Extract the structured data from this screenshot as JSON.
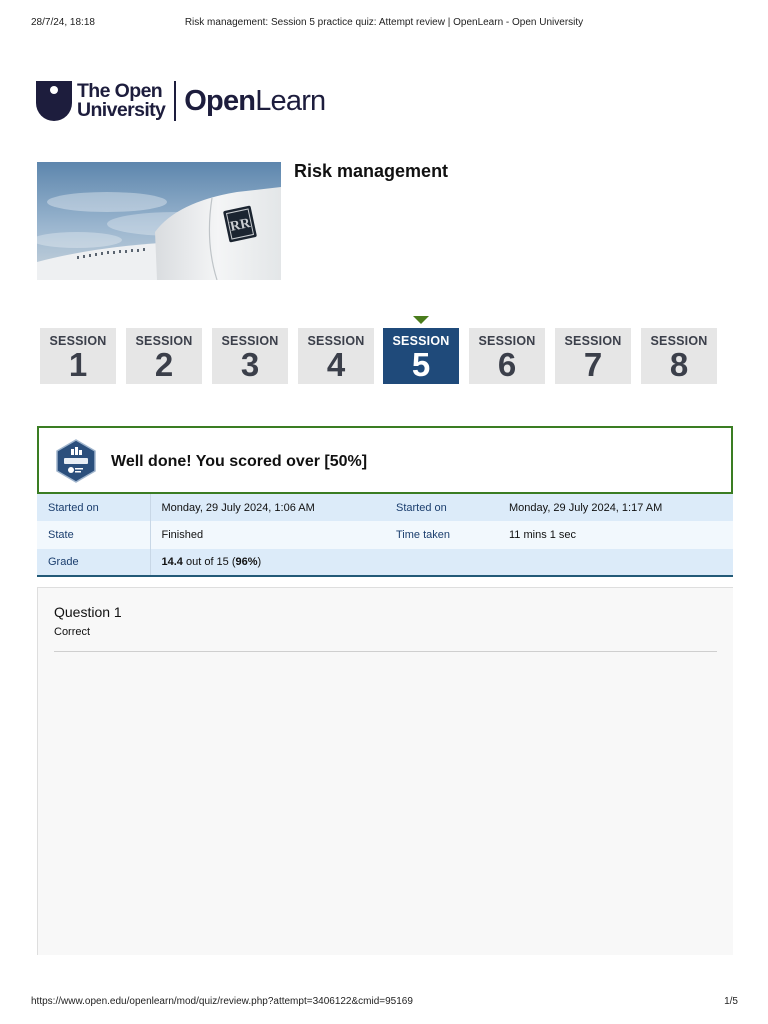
{
  "print_header": {
    "date": "28/7/24, 18:18",
    "title": "Risk management: Session 5 practice quiz: Attempt review | OpenLearn - Open University"
  },
  "logo": {
    "ou_line1": "The Open",
    "ou_line2": "University",
    "openlearn_bold": "Open",
    "openlearn_light": "Learn"
  },
  "course": {
    "title": "Risk management",
    "image": "jet-engine-photo"
  },
  "sessions": [
    {
      "label": "SESSION",
      "number": "1",
      "active": false
    },
    {
      "label": "SESSION",
      "number": "2",
      "active": false
    },
    {
      "label": "SESSION",
      "number": "3",
      "active": false
    },
    {
      "label": "SESSION",
      "number": "4",
      "active": false
    },
    {
      "label": "SESSION",
      "number": "5",
      "active": true
    },
    {
      "label": "SESSION",
      "number": "6",
      "active": false
    },
    {
      "label": "SESSION",
      "number": "7",
      "active": false
    },
    {
      "label": "SESSION",
      "number": "8",
      "active": false
    }
  ],
  "score": {
    "message": "Well done! You scored over [50%]",
    "badge_icon": "course-badge-icon"
  },
  "summary": {
    "started_on_label": "Started on",
    "started_on_value": "Monday, 29 July 2024, 1:06 AM",
    "completed_on_label": "Started on",
    "completed_on_value": "Monday, 29 July 2024, 1:17 AM",
    "state_label": "State",
    "state_value": "Finished",
    "time_taken_label": "Time taken",
    "time_taken_value": "11 mins 1 sec",
    "grade_label": "Grade",
    "grade_score": "14.4",
    "grade_mid": " out of 15 (",
    "grade_percent": "96%",
    "grade_end": ")"
  },
  "question": {
    "title": "Question 1",
    "status": "Correct"
  },
  "print_footer": {
    "url": "https://www.open.edu/openlearn/mod/quiz/review.php?attempt=3406122&cmid=95169",
    "page": "1/5"
  },
  "colors": {
    "active_session": "#1f4a7a",
    "session_bg": "#e6e6e6",
    "score_border": "#3a7d23",
    "table_row": "#dcebf9",
    "brand_navy": "#1d1d3d"
  }
}
